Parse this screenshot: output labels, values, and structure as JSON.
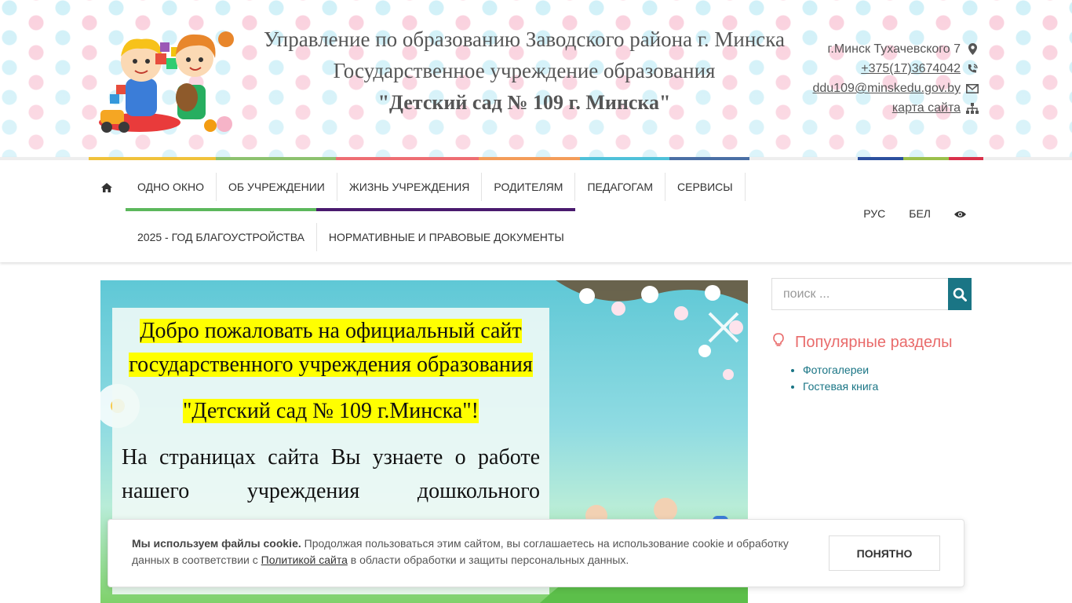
{
  "header": {
    "title_line1": "Управление по образованию Заводского района г. Минска",
    "title_line2": "Государственное учреждение образования",
    "title_line3": "\"Детский сад № 109 г. Минска\"",
    "logo_icon": "kids-playing-logo",
    "contacts": {
      "address": "г.Минск Тухачевского 7",
      "address_icon": "map-marker-icon",
      "phone": "+375(17)3674042",
      "phone_icon": "phone-volume-icon",
      "email": "ddu109@minskedu.gov.by",
      "email_icon": "envelope-icon",
      "sitemap": "карта сайта",
      "sitemap_icon": "sitemap-icon"
    }
  },
  "color_bars": [
    "#f0c23b",
    "#8dc26f",
    "#ee6e73",
    "#f49d5a",
    "#4fc1d9",
    "#4a6fa5",
    "#eeeeee",
    "#2b4f9e",
    "#9bc04b",
    "#d9304a"
  ],
  "nav": {
    "home_icon": "home-icon",
    "row1": [
      "ОДНО ОКНО",
      "ОБ УЧРЕЖДЕНИИ",
      "ЖИЗНЬ УЧРЕЖДЕНИЯ",
      "РОДИТЕЛЯМ",
      "ПЕДАГОГАМ",
      "СЕРВИСЫ"
    ],
    "row2": [
      "2025 - ГОД БЛАГОУСТРОЙСТВА",
      "НОРМАТИВНЫЕ И ПРАВОВЫЕ ДОКУМЕНТЫ"
    ],
    "lang_ru": "РУС",
    "lang_by": "БЕЛ",
    "accessibility_icon": "eye-icon",
    "accent_green": "#5cb85c",
    "accent_purple": "#4a1a6e"
  },
  "banner": {
    "line1": "Добро пожаловать на официальный сайт",
    "line2": "государственного учреждения образования",
    "line3": "\"Детский сад № 109 г.Минска\"!",
    "body": "На страницах сайта Вы узнаете о работе нашего учреждения дошкольного",
    "highlight_color": "#ffff00",
    "close_icon": "close-icon"
  },
  "sidebar": {
    "search_placeholder": "поиск ...",
    "search_icon": "search-icon",
    "popular_title": "Популярные разделы",
    "popular_icon": "lightbulb-icon",
    "popular_items": [
      "Фотогалереи",
      "Гостевая книга"
    ],
    "accent_color": "#1a7585",
    "title_color": "#e96b6b"
  },
  "cookie": {
    "bold": "Мы используем файлы cookie.",
    "text1": " Продолжая пользоваться этим сайтом, вы соглашаетесь на использование cookie и обработку данных в соответствии с ",
    "link": "Политикой сайта",
    "text2": " в области обработки и защиты персональных данных.",
    "button": "ПОНЯТНО"
  }
}
